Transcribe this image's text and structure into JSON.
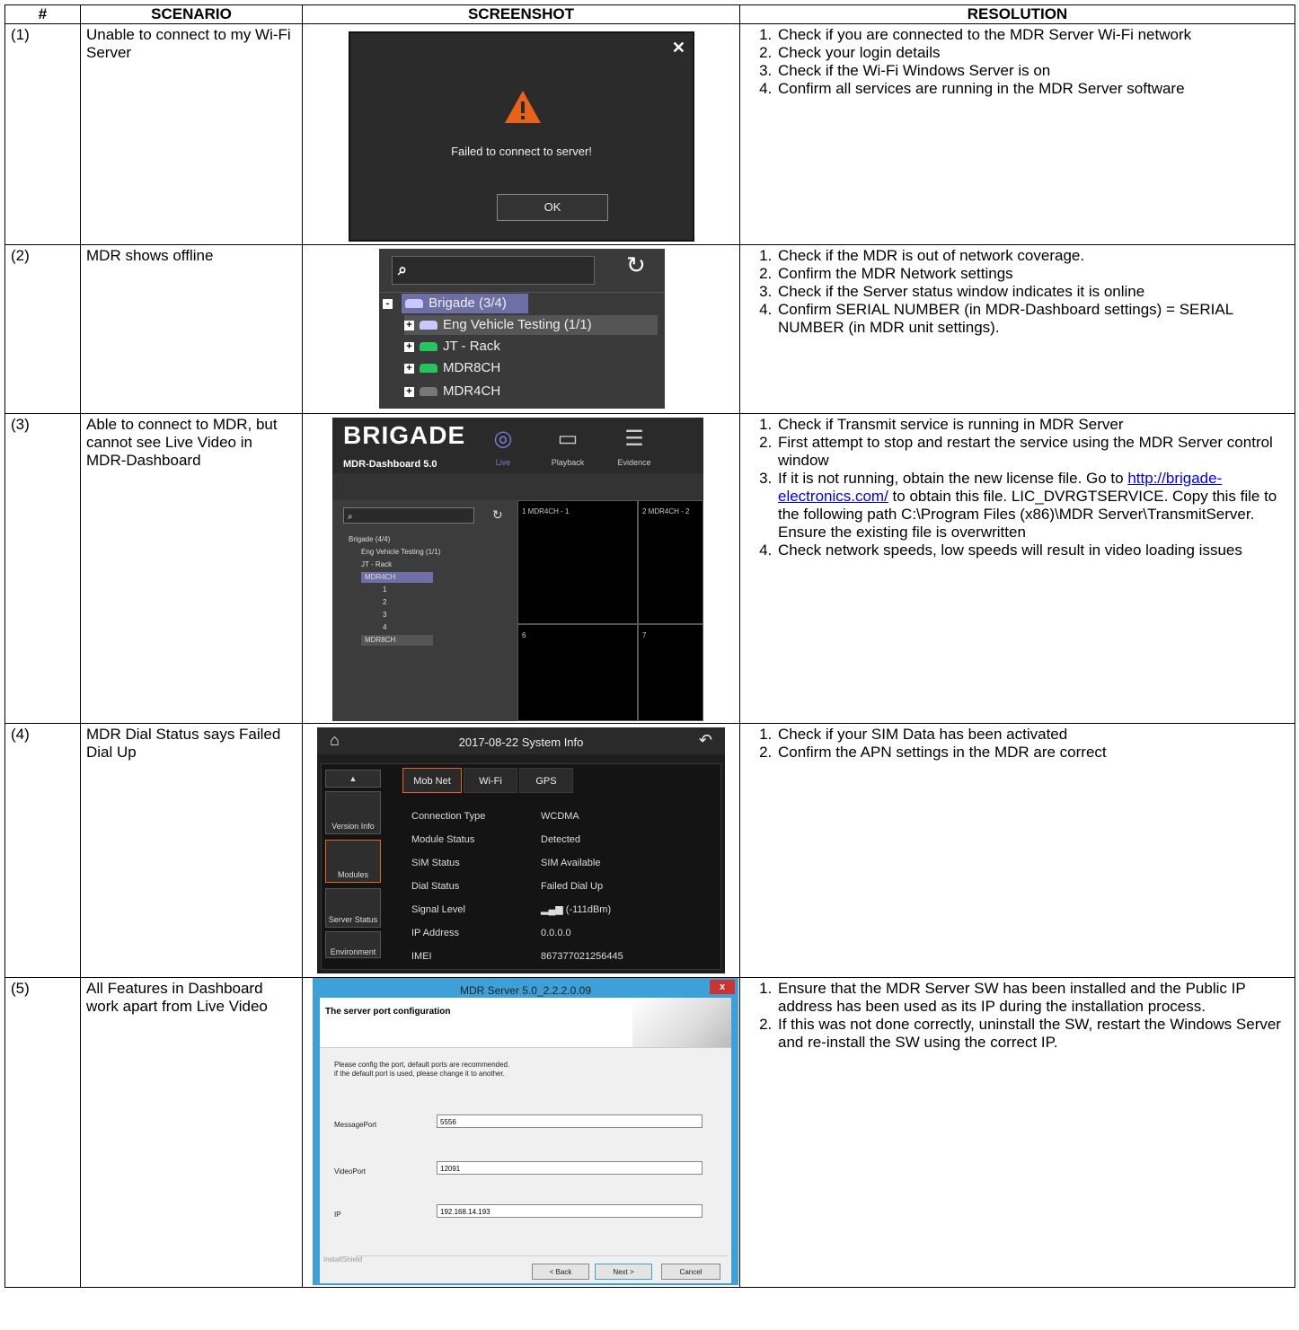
{
  "headers": {
    "num": "#",
    "scenario": "SCENARIO",
    "screenshot": "SCREENSHOT",
    "resolution": "RESOLUTION"
  },
  "rows": [
    {
      "num": "(1)",
      "scenario": "Unable to connect to my Wi-Fi Server",
      "resolution": [
        "Check if you are connected to the MDR Server Wi-Fi network",
        "Check your login details",
        "Check if the Wi-Fi Windows Server is on",
        "Confirm all services are running in the MDR Server software"
      ]
    },
    {
      "num": "(2)",
      "scenario": "MDR shows offline",
      "resolution": [
        "Check if the MDR is out of network coverage.",
        "Confirm the MDR Network settings",
        "Check if the Server status window indicates it is online",
        "Confirm SERIAL NUMBER (in MDR-Dashboard settings) = SERIAL NUMBER (in MDR unit settings)."
      ]
    },
    {
      "num": "(3)",
      "scenario": "Able to connect to MDR, but cannot see Live Video in MDR-Dashboard",
      "resolution_pre": [
        "Check if Transmit service is running in MDR Server",
        "First attempt to stop and restart the service using the MDR Server control window"
      ],
      "res3_a": "If it is not running, obtain the new license file. Go to ",
      "res3_link": "http://brigade-electronics.com/",
      "res3_b": " to obtain this file. LIC_DVRGTSERVICE. Copy this file to the following path C:\\Program Files (x86)\\MDR Server\\TransmitServer. Ensure the existing file is overwritten",
      "res3_4": "Check network speeds, low speeds will result in video loading issues"
    },
    {
      "num": "(4)",
      "scenario": "MDR Dial Status says Failed Dial Up",
      "resolution": [
        "Check if your SIM Data has been activated",
        "Confirm the APN settings in the MDR are correct"
      ]
    },
    {
      "num": "(5)",
      "scenario": "All Features in Dashboard work apart from Live Video",
      "resolution": [
        "Ensure that the MDR Server SW has been installed and the Public IP address has been used as its IP during the installation process.",
        "If this was not done correctly, uninstall the SW, restart the Windows Server and re-install the SW using the correct IP."
      ]
    }
  ],
  "shot1": {
    "message": "Failed to connect to server!",
    "ok": "OK",
    "close": "✕"
  },
  "shot2": {
    "items": [
      "Brigade (3/4)",
      "Eng Vehicle Testing (1/1)",
      "JT - Rack",
      "MDR8CH",
      "MDR4CH"
    ],
    "colors": {
      "online": "#22c55e",
      "offline": "#777777",
      "group": "#c8c8ff",
      "highlight": "#6f6fa8"
    }
  },
  "shot3": {
    "brand": "BRIGADE",
    "version": "MDR-Dashboard 5.0",
    "nav": [
      "Live",
      "Playback",
      "Evidence"
    ],
    "tree": [
      "Brigade (4/4)",
      "Eng Vehicle Testing (1/1)",
      "JT - Rack",
      "MDR4CH",
      "1",
      "2",
      "3",
      "4",
      "MDR8CH"
    ],
    "cells": [
      "1 MDR4CH - 1",
      "2 MDR4CH - 2",
      "6",
      "7"
    ]
  },
  "shot4": {
    "title": "2017-08-22  System Info",
    "tabs": [
      "Mob Net",
      "Wi-Fi",
      "GPS"
    ],
    "side": [
      "Version Info",
      "Modules",
      "Server Status",
      "Environment"
    ],
    "rows": [
      {
        "k": "Connection Type",
        "v": "WCDMA"
      },
      {
        "k": "Module Status",
        "v": "Detected"
      },
      {
        "k": "SIM Status",
        "v": "SIM Available"
      },
      {
        "k": "Dial Status",
        "v": "Failed Dial Up"
      },
      {
        "k": "Signal Level",
        "v": "(-111dBm)"
      },
      {
        "k": "IP Address",
        "v": "0.0.0.0"
      },
      {
        "k": "IMEI",
        "v": "867377021256445"
      }
    ]
  },
  "shot5": {
    "title": "MDR Server 5.0_2.2.2.0.09",
    "heading": "The server port configuration",
    "desc1": "Please config the port, default ports are recommended.",
    "desc2": "if the default port is used, please change it to another.",
    "fields": [
      {
        "label": "MessagePort",
        "value": "5556"
      },
      {
        "label": "VideoPort",
        "value": "12091"
      },
      {
        "label": "IP",
        "value": "192.168.14.193"
      }
    ],
    "installshield": "InstallShield",
    "buttons": [
      "< Back",
      "Next >",
      "Cancel"
    ]
  }
}
